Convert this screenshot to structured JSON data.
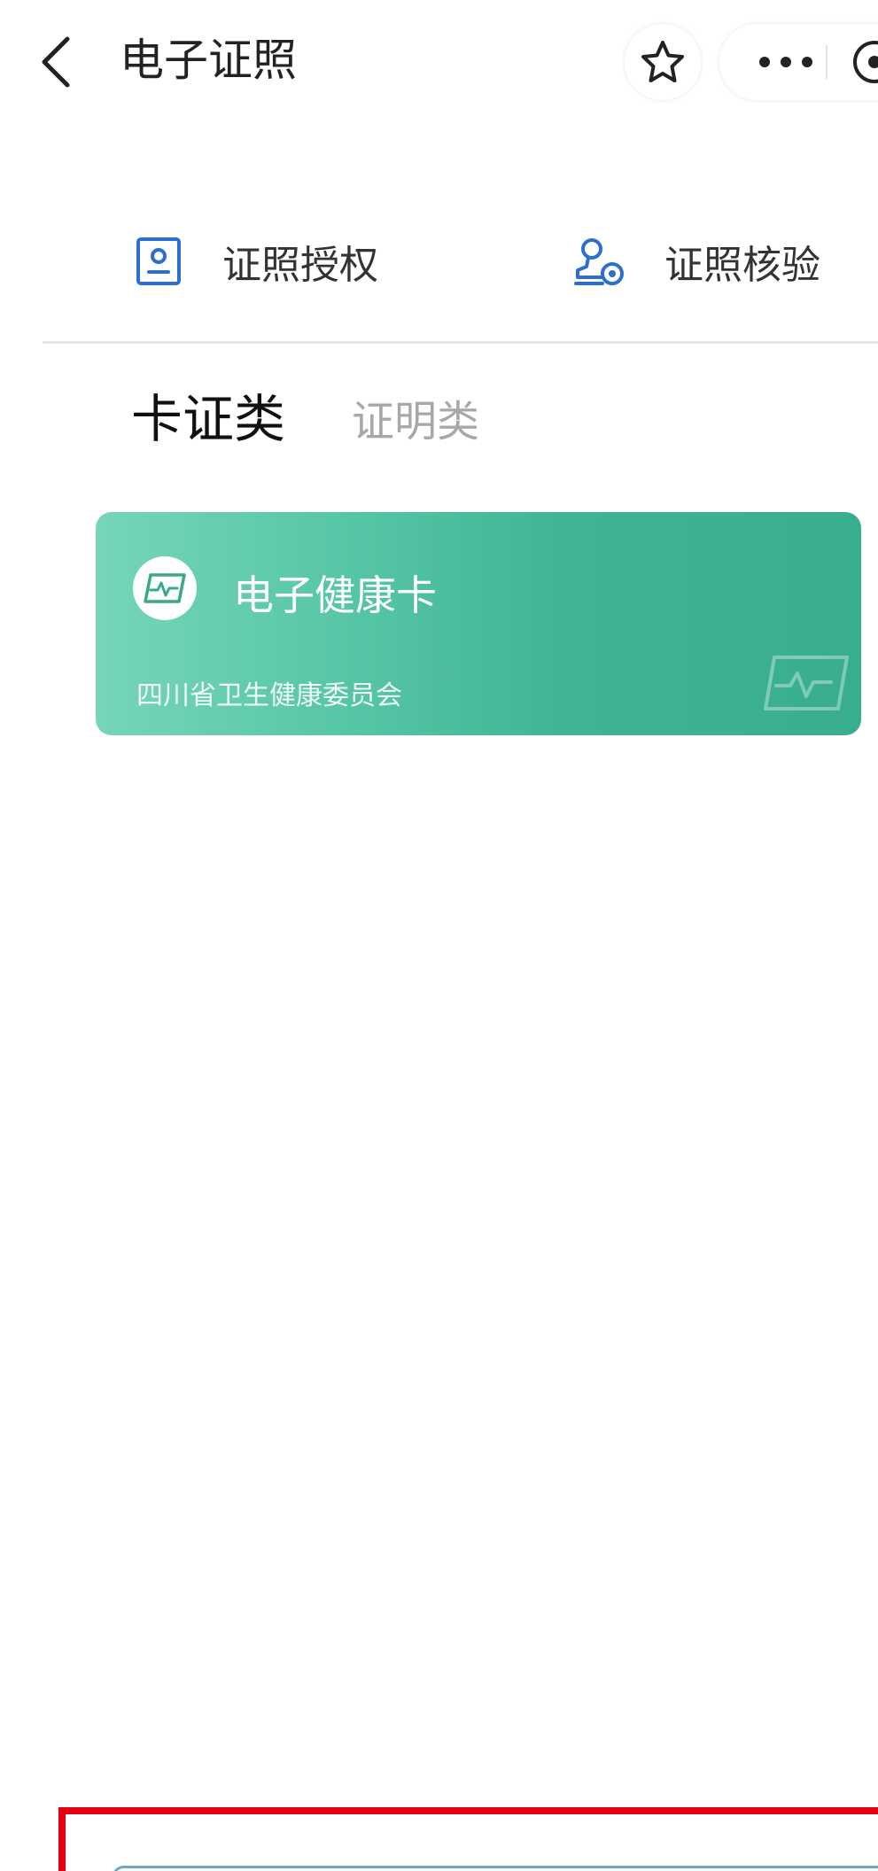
{
  "header": {
    "title": "电子证照"
  },
  "actions": {
    "authorize_label": "证照授权",
    "verify_label": "证照核验"
  },
  "tabs": [
    {
      "label": "卡证类",
      "selected": true
    },
    {
      "label": "证明类",
      "selected": false
    }
  ],
  "cards": [
    {
      "title": "电子健康卡",
      "issuer": "四川省卫生健康委员会",
      "icon": "health-card-icon"
    }
  ],
  "icons": {
    "back": "chevron-left-icon",
    "favorite": "star-icon",
    "more": "more-dots-icon",
    "close": "close-circle-icon",
    "authorize": "id-card-icon",
    "verify": "stamp-icon"
  },
  "colors": {
    "accent_blue": "#2d6fcf",
    "card_green_start": "#77d5b9",
    "card_green_end": "#39ae8e",
    "highlight_red": "#e60012"
  }
}
